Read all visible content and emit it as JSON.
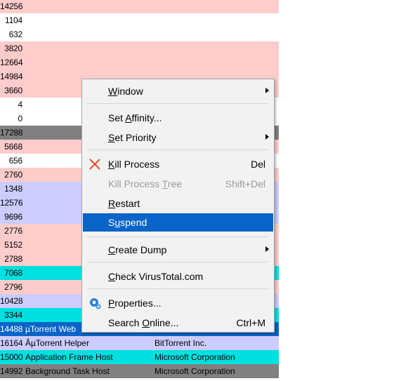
{
  "colors": {
    "pink": "#ffcccc",
    "white": "#ffffff",
    "gray": "#808080",
    "lavender": "#ccccff",
    "cyan": "#00e0e0",
    "selected_row": "#0a64c8",
    "menu_highlight": "#0a64c8"
  },
  "rows": [
    {
      "pid": "14256",
      "name": "",
      "company": "",
      "color": "pink"
    },
    {
      "pid": "1104",
      "name": "",
      "company": "",
      "color": "white"
    },
    {
      "pid": "632",
      "name": "",
      "company": "",
      "color": "white"
    },
    {
      "pid": "3820",
      "name": "",
      "company": "",
      "color": "pink"
    },
    {
      "pid": "12664",
      "name": "",
      "company": "",
      "color": "pink"
    },
    {
      "pid": "14984",
      "name": "",
      "company": "",
      "color": "pink"
    },
    {
      "pid": "3660",
      "name": "",
      "company": "",
      "color": "pink"
    },
    {
      "pid": "4",
      "name": "",
      "company": "",
      "color": "white"
    },
    {
      "pid": "0",
      "name": "",
      "company": "",
      "color": "white"
    },
    {
      "pid": "17288",
      "name": "",
      "company": "",
      "color": "gray"
    },
    {
      "pid": "5668",
      "name": "",
      "company": "",
      "color": "pink"
    },
    {
      "pid": "656",
      "name": "",
      "company": "",
      "color": "white"
    },
    {
      "pid": "2760",
      "name": "",
      "company": "",
      "color": "pink"
    },
    {
      "pid": "1348",
      "name": "",
      "company": "",
      "color": "lavender"
    },
    {
      "pid": "12576",
      "name": "",
      "company": "",
      "color": "lavender"
    },
    {
      "pid": "9696",
      "name": "",
      "company": "",
      "color": "lavender"
    },
    {
      "pid": "2776",
      "name": "",
      "company": "",
      "color": "pink"
    },
    {
      "pid": "5152",
      "name": "",
      "company": "",
      "color": "pink"
    },
    {
      "pid": "2788",
      "name": "",
      "company": "",
      "color": "pink"
    },
    {
      "pid": "7068",
      "name": "",
      "company": "",
      "color": "cyan"
    },
    {
      "pid": "2796",
      "name": "",
      "company": "",
      "color": "pink"
    },
    {
      "pid": "10428",
      "name": "",
      "company": "",
      "color": "lavender"
    },
    {
      "pid": "3344",
      "name": "",
      "company": "",
      "color": "cyan"
    },
    {
      "pid": "14488",
      "name": "µTorrent Web",
      "company": "",
      "color": "selected_row"
    },
    {
      "pid": "16164",
      "name": "ÂµTorrent Helper",
      "company": "BitTorrent Inc.",
      "color": "lavender"
    },
    {
      "pid": "15000",
      "name": "Application Frame Host",
      "company": "Microsoft Corporation",
      "color": "cyan"
    },
    {
      "pid": "14992",
      "name": "Background Task Host",
      "company": "Microsoft Corporation",
      "color": "gray"
    }
  ],
  "menu": {
    "window": {
      "pre": "",
      "u": "W",
      "post": "indow"
    },
    "set_affinity": {
      "pre": "Set ",
      "u": "A",
      "post": "ffinity..."
    },
    "set_priority": {
      "pre": "",
      "u": "S",
      "post": "et Priority"
    },
    "kill_process": {
      "pre": "",
      "u": "K",
      "post": "ill Process",
      "shortcut": "Del"
    },
    "kill_tree": {
      "pre": "Kill Process ",
      "u": "T",
      "post": "ree",
      "shortcut": "Shift+Del"
    },
    "restart": {
      "pre": "",
      "u": "R",
      "post": "estart"
    },
    "suspend": {
      "pre": "S",
      "u": "u",
      "post": "spend"
    },
    "create_dump": {
      "pre": "",
      "u": "C",
      "post": "reate Dump"
    },
    "check_vt": {
      "pre": "",
      "u": "C",
      "post": "heck VirusTotal.com"
    },
    "properties": {
      "pre": "",
      "u": "P",
      "post": "roperties..."
    },
    "search_online": {
      "pre": "Search ",
      "u": "O",
      "post": "nline...",
      "shortcut": "Ctrl+M"
    },
    "icons": {
      "kill": "x-icon",
      "properties": "properties-gear-icon",
      "submenu": "chevron-right-icon"
    }
  }
}
